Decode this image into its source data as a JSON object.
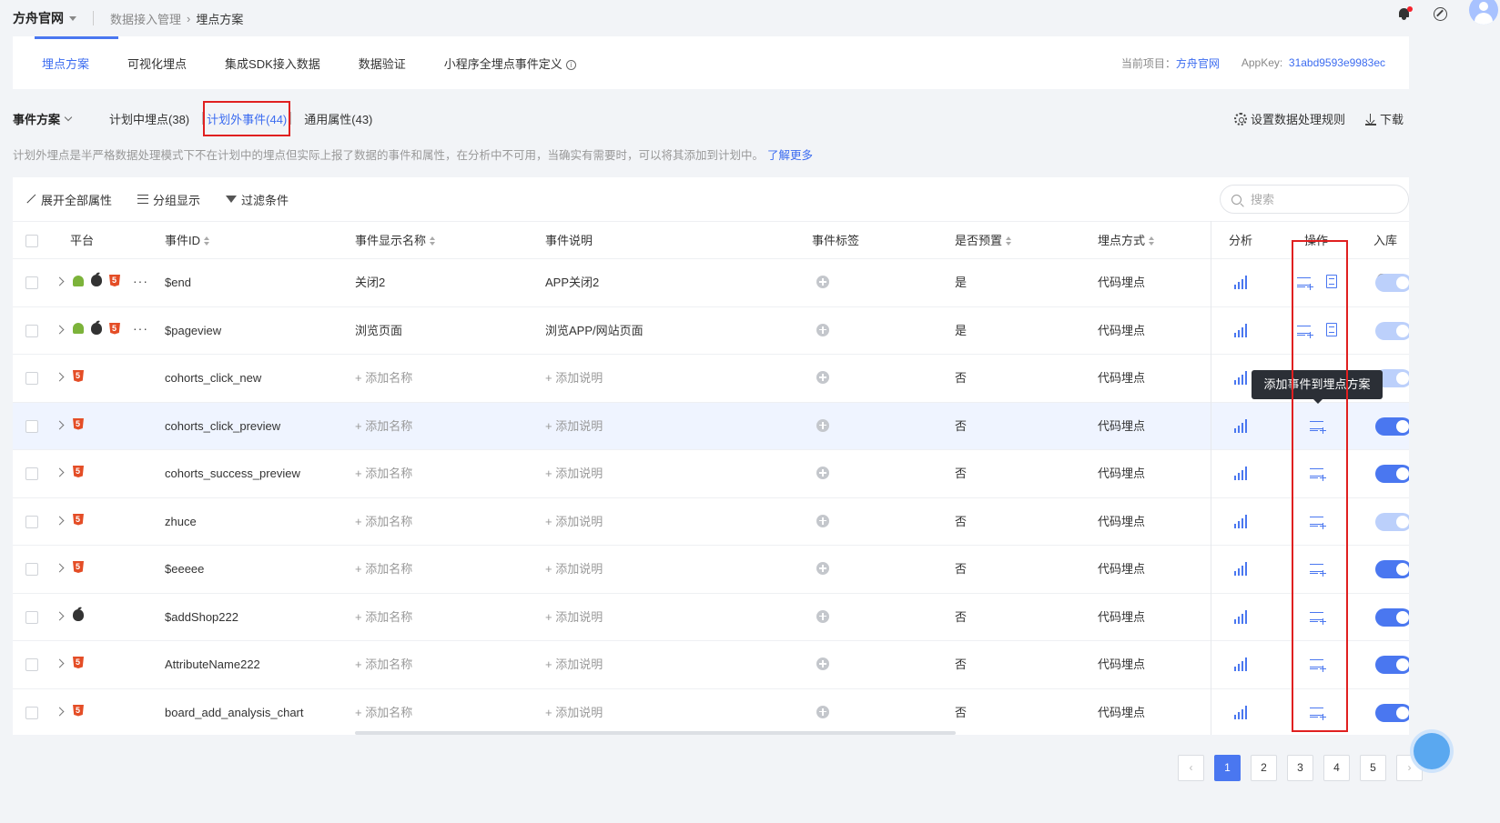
{
  "topbar": {
    "brand": "方舟官网",
    "breadcrumb": [
      "数据接入管理",
      "埋点方案"
    ]
  },
  "nav": {
    "tabs": [
      "埋点方案",
      "可视化埋点",
      "集成SDK接入数据",
      "数据验证",
      "小程序全埋点事件定义"
    ],
    "active_tab": 0,
    "project_label": "当前项目：",
    "project_value": "方舟官网",
    "appkey_label": "AppKey:",
    "appkey_value": "31abd9593e9983ec"
  },
  "scheme": {
    "title": "事件方案",
    "tabs": [
      "计划中埋点(38)",
      "计划外事件(44)",
      "通用属性(43)"
    ],
    "active_tab": 1,
    "settings_label": "设置数据处理规则",
    "download_label": "下载"
  },
  "description": {
    "text": "计划外埋点是半严格数据处理模式下不在计划中的埋点但实际上报了数据的事件和属性，在分析中不可用，当确实有需要时，可以将其添加到计划中。",
    "link": "了解更多"
  },
  "toolbar": {
    "expand_label": "展开全部属性",
    "group_label": "分组显示",
    "filter_label": "过滤条件",
    "search_placeholder": "搜索"
  },
  "table": {
    "columns": [
      "平台",
      "事件ID",
      "事件显示名称",
      "事件说明",
      "事件标签",
      "是否预置",
      "埋点方式",
      "分析",
      "操作",
      "入库"
    ],
    "rows": [
      {
        "platforms": [
          "android",
          "apple",
          "html5",
          "more"
        ],
        "id": "$end",
        "name": "关闭2",
        "desc": "APP关闭2",
        "preset": "是",
        "method": "代码埋点",
        "doc": true,
        "enabled": false
      },
      {
        "platforms": [
          "android",
          "apple",
          "html5",
          "more"
        ],
        "id": "$pageview",
        "name": "浏览页面",
        "desc": "浏览APP/网站页面",
        "preset": "是",
        "method": "代码埋点",
        "doc": true,
        "enabled": false
      },
      {
        "platforms": [
          "html5"
        ],
        "id": "cohorts_click_new",
        "name": "+ 添加名称",
        "desc": "+ 添加说明",
        "preset": "否",
        "method": "代码埋点",
        "doc": false,
        "enabled": false
      },
      {
        "platforms": [
          "html5"
        ],
        "id": "cohorts_click_preview",
        "name": "+ 添加名称",
        "desc": "+ 添加说明",
        "preset": "否",
        "method": "代码埋点",
        "doc": false,
        "enabled": true
      },
      {
        "platforms": [
          "html5"
        ],
        "id": "cohorts_success_preview",
        "name": "+ 添加名称",
        "desc": "+ 添加说明",
        "preset": "否",
        "method": "代码埋点",
        "doc": false,
        "enabled": true
      },
      {
        "platforms": [
          "html5"
        ],
        "id": "zhuce",
        "name": "+ 添加名称",
        "desc": "+ 添加说明",
        "preset": "否",
        "method": "代码埋点",
        "doc": false,
        "enabled": false
      },
      {
        "platforms": [
          "html5"
        ],
        "id": "$eeeee",
        "name": "+ 添加名称",
        "desc": "+ 添加说明",
        "preset": "否",
        "method": "代码埋点",
        "doc": false,
        "enabled": true
      },
      {
        "platforms": [
          "apple"
        ],
        "id": "$addShop222",
        "name": "+ 添加名称",
        "desc": "+ 添加说明",
        "preset": "否",
        "method": "代码埋点",
        "doc": false,
        "enabled": true
      },
      {
        "platforms": [
          "html5"
        ],
        "id": "AttributeName222",
        "name": "+ 添加名称",
        "desc": "+ 添加说明",
        "preset": "否",
        "method": "代码埋点",
        "doc": false,
        "enabled": true
      },
      {
        "platforms": [
          "html5"
        ],
        "id": "board_add_analysis_chart",
        "name": "+ 添加名称",
        "desc": "+ 添加说明",
        "preset": "否",
        "method": "代码埋点",
        "doc": false,
        "enabled": true
      }
    ],
    "hover_row": 3
  },
  "tooltip": {
    "text": "添加事件到埋点方案"
  },
  "pagination": {
    "pages": [
      "1",
      "2",
      "3",
      "4",
      "5"
    ],
    "current": "1",
    "prev": "‹",
    "next": "›"
  },
  "colors": {
    "accent": "#4a77f0",
    "highlight": "#e02020",
    "tooltip_bg": "#2b2f36"
  }
}
